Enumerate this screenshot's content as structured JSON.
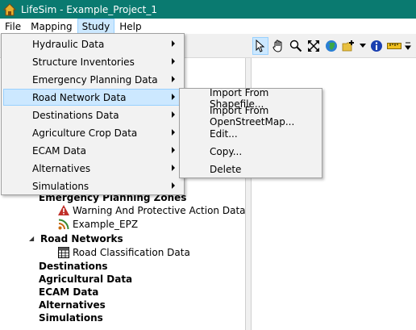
{
  "window": {
    "title": "LifeSim - Example_Project_1"
  },
  "menubar": {
    "items": [
      "File",
      "Mapping",
      "Study",
      "Help"
    ]
  },
  "study_menu": {
    "items": [
      "Hydraulic Data",
      "Structure Inventories",
      "Emergency Planning Data",
      "Road Network Data",
      "Destinations Data",
      "Agriculture Crop Data",
      "ECAM Data",
      "Alternatives",
      "Simulations"
    ],
    "highlighted": "Road Network Data"
  },
  "road_network_submenu": {
    "items": [
      "Import From Shapefile...",
      "Import From OpenStreetMap...",
      "Edit...",
      "Copy...",
      "Delete"
    ]
  },
  "tree": {
    "emergency_planning_zones": "Emergency Planning Zones",
    "warning_and_protective_action": "Warning And Protective Action Data",
    "example_epz": "Example_EPZ",
    "road_networks": "Road Networks",
    "road_classification": "Road Classification Data",
    "destinations": "Destinations",
    "agricultural_data": "Agricultural Data",
    "ecam_data": "ECAM Data",
    "alternatives": "Alternatives",
    "simulations": "Simulations"
  },
  "colors": {
    "titlebar": "#0a7a70",
    "highlight": "#cce8ff",
    "highlight_border": "#99d1ff"
  }
}
